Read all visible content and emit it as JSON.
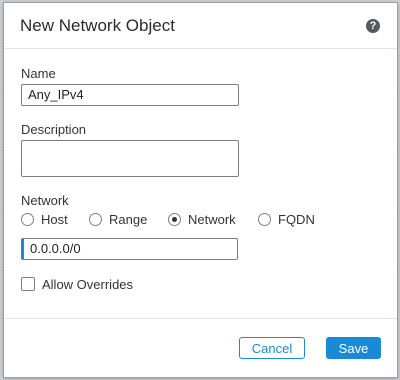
{
  "dialog": {
    "title": "New Network Object",
    "help_icon": "?"
  },
  "form": {
    "name_label": "Name",
    "name_value": "Any_IPv4",
    "description_label": "Description",
    "description_value": "",
    "network_label": "Network",
    "network_types": [
      {
        "label": "Host",
        "selected": false
      },
      {
        "label": "Range",
        "selected": false
      },
      {
        "label": "Network",
        "selected": true
      },
      {
        "label": "FQDN",
        "selected": false
      }
    ],
    "network_value": "0.0.0.0/0",
    "allow_overrides_label": "Allow Overrides",
    "allow_overrides_checked": false
  },
  "footer": {
    "cancel_label": "Cancel",
    "save_label": "Save"
  },
  "colors": {
    "accent": "#1b8ad4",
    "text": "#333333",
    "border": "#7a7f85"
  },
  "icons": {
    "help": "help-icon"
  }
}
